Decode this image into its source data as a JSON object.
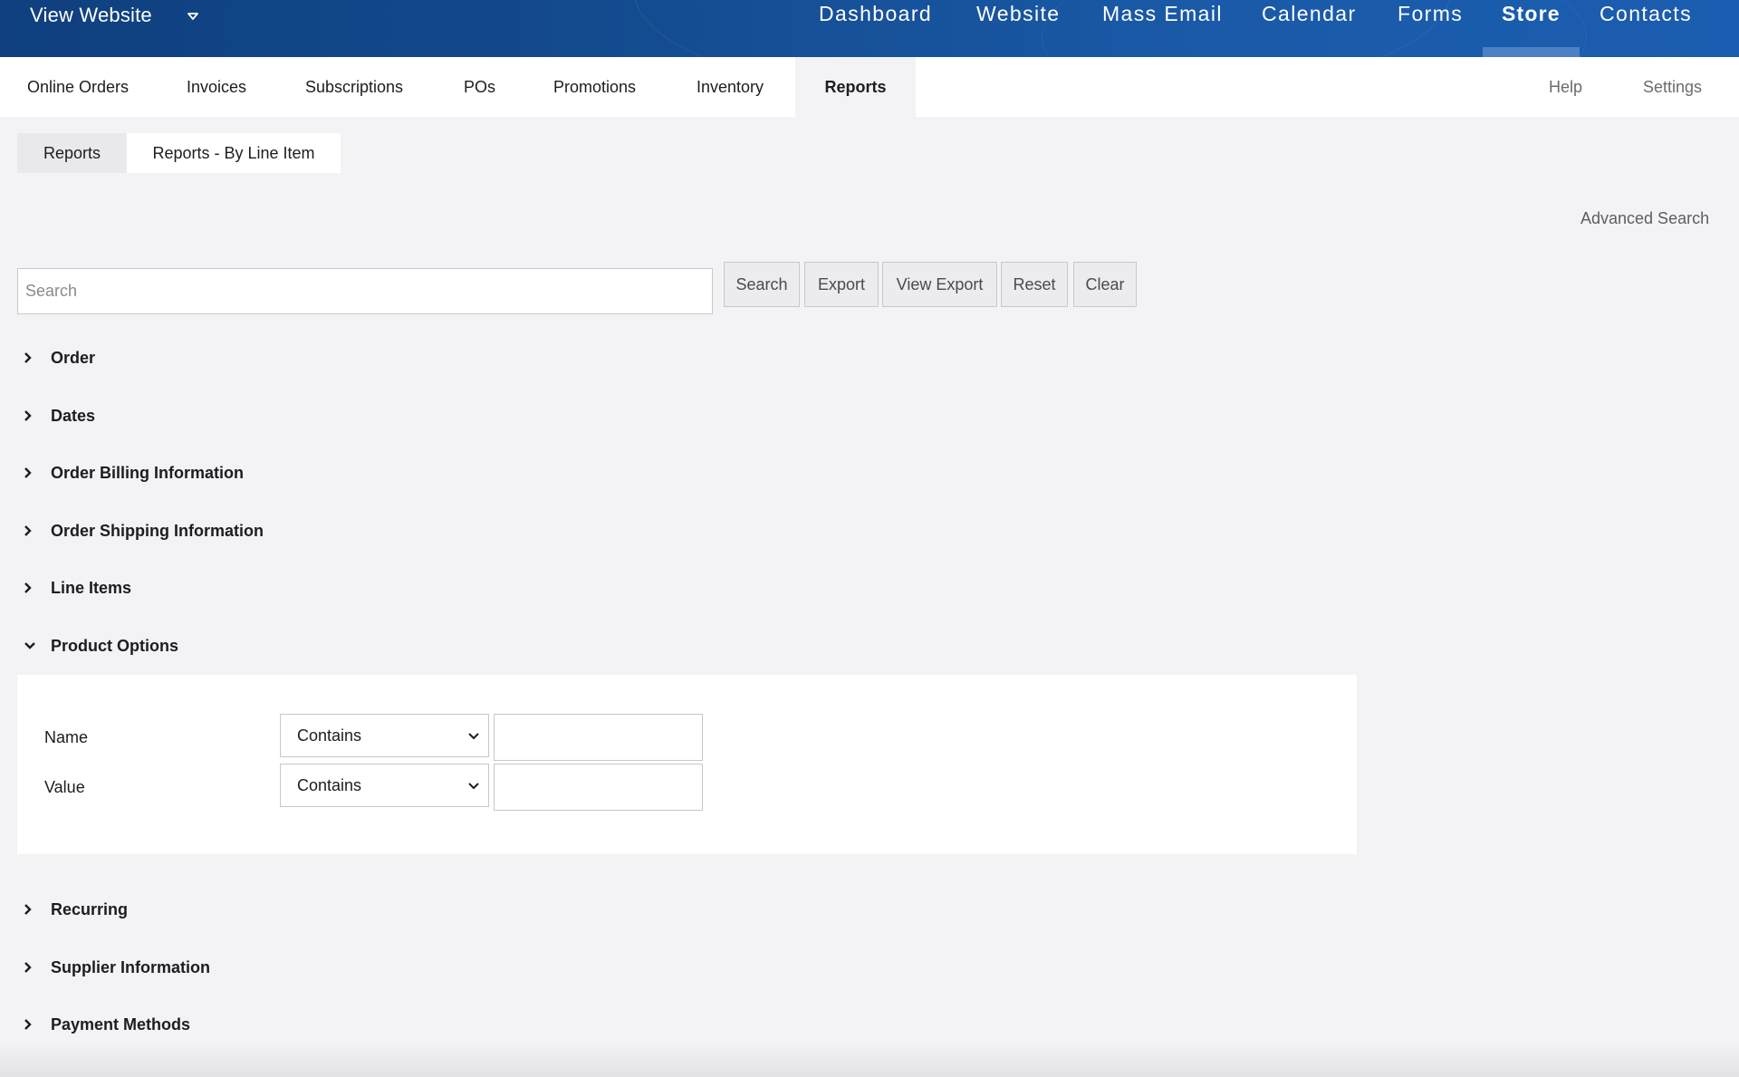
{
  "header": {
    "view_website": "View Website",
    "nav": [
      {
        "label": "Dashboard"
      },
      {
        "label": "Website"
      },
      {
        "label": "Mass Email"
      },
      {
        "label": "Calendar"
      },
      {
        "label": "Forms"
      },
      {
        "label": "Store",
        "active": true
      },
      {
        "label": "Contacts"
      }
    ]
  },
  "subnav": {
    "tabs": [
      {
        "label": "Online Orders"
      },
      {
        "label": "Invoices"
      },
      {
        "label": "Subscriptions"
      },
      {
        "label": "POs"
      },
      {
        "label": "Promotions"
      },
      {
        "label": "Inventory"
      },
      {
        "label": "Reports",
        "active": true
      }
    ],
    "right": [
      {
        "label": "Help"
      },
      {
        "label": "Settings"
      }
    ]
  },
  "report_tabs": [
    {
      "label": "Reports"
    },
    {
      "label": "Reports - By Line Item"
    }
  ],
  "advanced_search": "Advanced Search",
  "search": {
    "placeholder": "Search",
    "value": "",
    "buttons": [
      {
        "label": "Search"
      },
      {
        "label": "Export"
      },
      {
        "label": "View Export"
      },
      {
        "label": "Reset"
      },
      {
        "label": "Clear"
      }
    ]
  },
  "sections": [
    {
      "label": "Order",
      "expanded": false
    },
    {
      "label": "Dates",
      "expanded": false
    },
    {
      "label": "Order Billing Information",
      "expanded": false
    },
    {
      "label": "Order Shipping Information",
      "expanded": false
    },
    {
      "label": "Line Items",
      "expanded": false
    },
    {
      "label": "Product Options",
      "expanded": true
    },
    {
      "label": "Recurring",
      "expanded": false
    },
    {
      "label": "Supplier Information",
      "expanded": false
    },
    {
      "label": "Payment Methods",
      "expanded": false
    }
  ],
  "product_options": {
    "rows": [
      {
        "label": "Name",
        "operator": "Contains",
        "value": ""
      },
      {
        "label": "Value",
        "operator": "Contains",
        "value": ""
      }
    ]
  },
  "colors": {
    "header_bg": "#144b8f",
    "page_bg": "#f3f3f5",
    "active_indicator": "#4d80c4"
  },
  "icons": {
    "view_website_caret": "caret-down-icon",
    "section_collapsed": "chevron-right-icon",
    "section_expanded": "chevron-down-icon",
    "select_dropdown": "chevron-down-icon"
  }
}
